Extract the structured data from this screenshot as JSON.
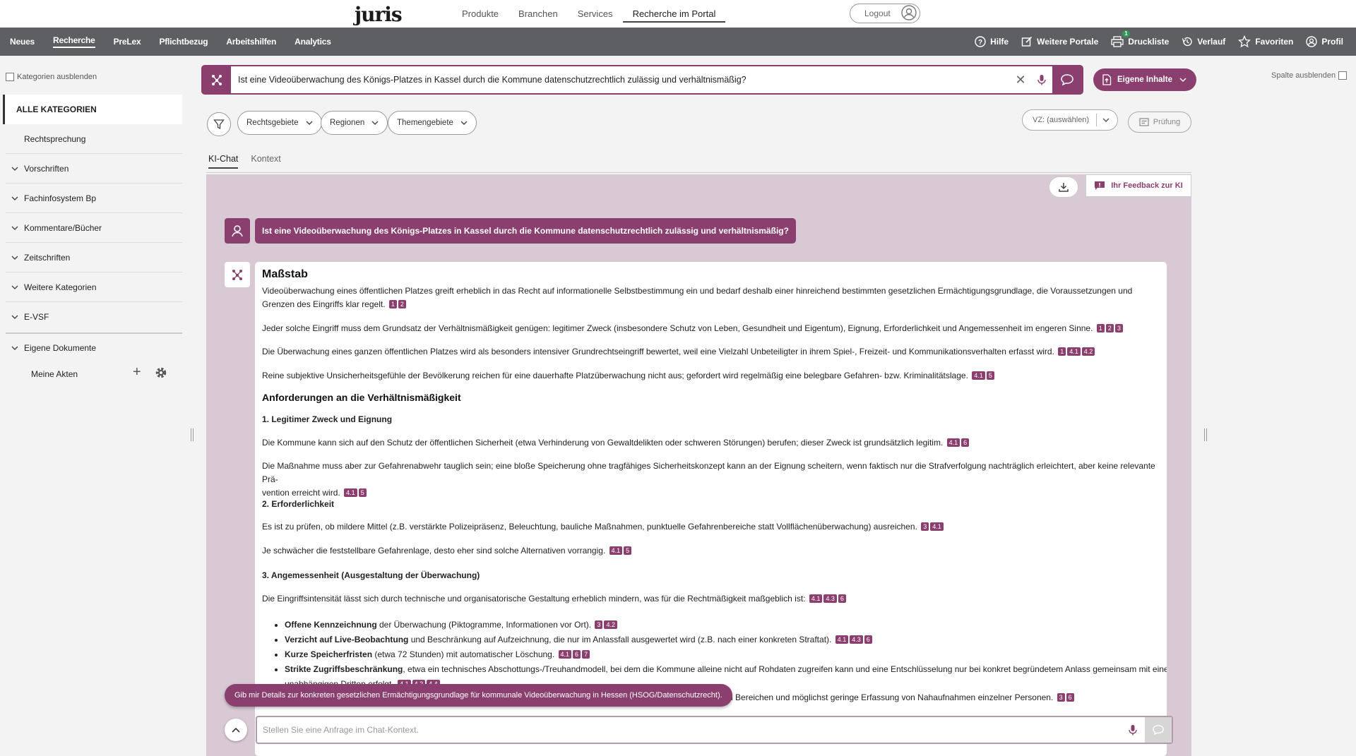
{
  "topbar": {
    "logo": "juris",
    "nav": [
      "Produkte",
      "Branchen",
      "Services",
      "Recherche im Portal"
    ],
    "logout": "Logout"
  },
  "menubar": {
    "left": [
      "Neues",
      "Recherche",
      "PreLex",
      "Pflichtbezug",
      "Arbeitshilfen",
      "Analytics"
    ],
    "right": {
      "hilfe": "Hilfe",
      "portale": "Weitere Portale",
      "druckliste": "Druckliste",
      "druckliste_badge": "1",
      "verlauf": "Verlauf",
      "favoriten": "Favoriten",
      "profil": "Profil"
    }
  },
  "sidebar": {
    "hide_label": "Kategorien ausblenden",
    "all": "ALLE KATEGORIEN",
    "items": [
      "Rechtsprechung",
      "Vorschriften",
      "Fachinfosystem Bp",
      "Kommentare/Bücher",
      "Zeitschriften",
      "Weitere Kategorien",
      "E-VSF",
      "Eigene Dokumente"
    ],
    "meine_akten": "Meine Akten"
  },
  "search": {
    "query": "Ist eine Videoüberwachung des Königs-Platzes in Kassel durch die Kommune datenschutzrechtlich zulässig und verhältnismäßig?",
    "eigene_inhalte": "Eigene Inhalte",
    "spalte": "Spalte ausblenden"
  },
  "filters": {
    "pills": [
      "Rechtsgebiete",
      "Regionen",
      "Themengebiete"
    ],
    "vz": "VZ: (auswählen)",
    "pruefung": "Prüfung"
  },
  "tabs": [
    "KI-Chat",
    "Kontext"
  ],
  "chat": {
    "feedback": "Ihr Feedback zur KI",
    "user_message": "Ist eine Videoüberwachung des Königs-Platzes in Kassel durch die Kommune datenschutzrechtlich zulässig und verhältnismäßig?",
    "answer": {
      "h_massstab": "Maßstab",
      "p1": "Videoüberwachung eines öffentlichen Platzes greift erheblich in das Recht auf informationelle Selbstbestimmung ein und bedarf deshalb einer hinreichend bestimmten gesetzlichen Ermächtigungsgrundlage, die Voraussetzungen und Grenzen des Eingriffs klar regelt.",
      "p2": "Jeder solche Eingriff muss dem Grundsatz der Verhältnismäßigkeit genügen: legitimer Zweck (insbesondere Schutz von Leben, Gesundheit und Eigentum), Eignung, Erforderlichkeit und Angemessenheit im engeren Sinne.",
      "p3": "Die Überwachung eines ganzen öffentlichen Platzes wird als besonders intensiver Grundrechtseingriff bewertet, weil eine Vielzahl Unbeteiligter in ihrem Spiel-, Freizeit- und Kommunikationsverhalten erfasst wird.",
      "p4": "Reine subjektive Unsicherheitsgefühle der Bevölkerung reichen für eine dauerhafte Platzüberwachung nicht aus; gefordert wird regelmäßig eine belegbare Gefahren- bzw. Kriminalitätslage.",
      "h_anforderungen": "Anforderungen an die Verhältnismäßigkeit",
      "s1": "1. Legitimer Zweck und Eignung",
      "p5": "Die Kommune kann sich auf den Schutz der öffentlichen Sicherheit (etwa Verhinderung von Gewaltdelikten oder schweren Störungen) berufen; dieser Zweck ist grundsätzlich legitim.",
      "p6a": "Die Maßnahme muss aber zur Gefahrenabwehr tauglich sein; eine bloße Speicherung ohne tragfähiges Sicherheitskonzept kann an der Eignung scheitern, wenn faktisch nur die Strafverfolgung nachträglich erleichtert, aber keine relevante Prä-",
      "p6b": "vention erreicht wird.",
      "s2": "2. Erforderlichkeit",
      "p7": "Es ist zu prüfen, ob mildere Mittel (z.B. verstärkte Polizeipräsenz, Beleuchtung, bauliche Maßnahmen, punktuelle Gefahrenbereiche statt Vollflächenüberwachung) ausreichen.",
      "p8": "Je schwächer die feststellbare Gefahrenlage, desto eher sind solche Alternativen vorrangig.",
      "s3": "3. Angemessenheit (Ausgestaltung der Überwachung)",
      "p9": "Die Eingriffsintensität lässt sich durch technische und organisatorische Gestaltung erheblich mindern, was für die Rechtmäßigkeit maßgeblich ist:",
      "li1_b": "Offene Kennzeichnung",
      "li1": " der Überwachung (Piktogramme, Informationen vor Ort).",
      "li2_b": "Verzicht auf Live-Beobachtung",
      "li2": " und Beschränkung auf Aufzeichnung, die nur im Anlassfall ausgewertet wird (z.B. nach einer konkreten Straftat).",
      "li3_b": "Kurze Speicherfristen",
      "li3": " (etwa 72 Stunden) mit automatischer Löschung.",
      "li4_b": "Strikte Zugriffsbeschränkung",
      "li4": ", etwa ein technisches Abschottungs-/Treuhandmodell, bei dem die Kommune alleine nicht auf Rohdaten zugreifen kann und eine Entschlüsselung nur bei konkret begründetem Anlass gemeinsam mit einem",
      "li4b": "unabhängigen Dritten erfolgt.",
      "li5_tail": "ar intimen Bereichen und möglichst geringe Erfassung von Nahaufnahmen einzelner Personen."
    },
    "refs": {
      "p1": [
        "1",
        "2"
      ],
      "p2": [
        "1",
        "2",
        "3"
      ],
      "p3": [
        "1",
        "4.1",
        "4.2"
      ],
      "p4": [
        "4.1",
        "5"
      ],
      "p5": [
        "4.1",
        "6"
      ],
      "p6": [
        "4.1",
        "5"
      ],
      "p7": [
        "3",
        "4.1"
      ],
      "p8": [
        "4.1",
        "5"
      ],
      "p9": [
        "4.1",
        "4.3",
        "6"
      ],
      "li1": [
        "3",
        "4.2"
      ],
      "li2": [
        "4.1",
        "4.3",
        "6"
      ],
      "li3": [
        "4.1",
        "6",
        "7"
      ],
      "li4": [
        "4.1",
        "4.2",
        "4.4"
      ],
      "li5": [
        "3",
        "6"
      ]
    },
    "suggestion": "Gib mir Details zur konkreten gesetzlichen Ermächtigungsgrundlage für kommunale Videoüberwachung in Hessen (HSOG/Datenschutzrecht).",
    "input_placeholder": "Stellen Sie eine Anfrage im Chat-Kontext."
  },
  "colors": {
    "accent": "#8b3f6f",
    "menubar": "#5d5f62",
    "chat_bg": "#d8c9d4"
  }
}
